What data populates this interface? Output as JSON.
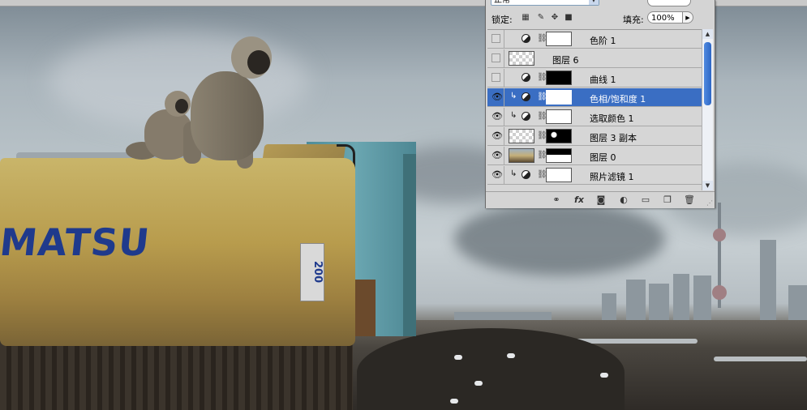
{
  "panel": {
    "blend_mode": "正常",
    "lock_label": "锁定:",
    "fill_label": "填充:",
    "fill_value": "100%",
    "layers": [
      {
        "name": "色阶 1",
        "visible": false,
        "selected": false,
        "clipped": false,
        "adjustment": true,
        "thumb": "white"
      },
      {
        "name": "图层 6",
        "visible": false,
        "selected": false,
        "clipped": false,
        "adjustment": false,
        "thumb": "checker"
      },
      {
        "name": "曲线 1",
        "visible": false,
        "selected": false,
        "clipped": false,
        "adjustment": true,
        "thumb": "black"
      },
      {
        "name": "色相/饱和度 1",
        "visible": true,
        "selected": true,
        "clipped": true,
        "adjustment": true,
        "thumb": "white"
      },
      {
        "name": "选取颜色 1",
        "visible": true,
        "selected": false,
        "clipped": true,
        "adjustment": true,
        "thumb": "white"
      },
      {
        "name": "图层 3 副本",
        "visible": true,
        "selected": false,
        "clipped": false,
        "adjustment": false,
        "thumb": "checker",
        "mask": "mask3"
      },
      {
        "name": "图层 0",
        "visible": true,
        "selected": false,
        "clipped": false,
        "adjustment": false,
        "thumb": "photo",
        "mask": "mask0"
      },
      {
        "name": "照片滤镜 1",
        "visible": true,
        "selected": false,
        "clipped": true,
        "adjustment": true,
        "thumb": "white"
      }
    ],
    "bottom_icons": [
      "link-layers-icon",
      "fx-icon",
      "add-mask-icon",
      "adjustment-layer-icon",
      "new-group-icon",
      "new-layer-icon",
      "trash-icon"
    ]
  },
  "photo": {
    "brand_text": "MATSU",
    "model_text": "200"
  },
  "colors": {
    "selection": "#3a6ec3",
    "panel_bg": "#d4d4d4",
    "brand_blue": "#1f3a8c"
  }
}
